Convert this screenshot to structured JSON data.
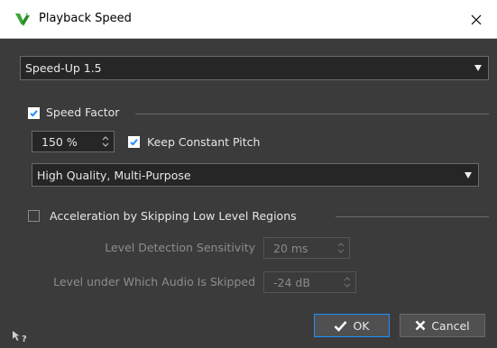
{
  "window": {
    "title": "Playback Speed"
  },
  "preset": {
    "value": "Speed-Up 1.5"
  },
  "speed_factor": {
    "label": "Speed Factor",
    "checked": true,
    "value": "150 %",
    "keep_pitch_label": "Keep Constant Pitch",
    "keep_pitch_checked": true,
    "quality_value": "High Quality, Multi-Purpose"
  },
  "acceleration": {
    "label": "Acceleration by Skipping Low Level Regions",
    "checked": false,
    "sensitivity_label": "Level Detection Sensitivity",
    "sensitivity_value": "20 ms",
    "threshold_label": "Level under Which Audio Is Skipped",
    "threshold_value": "-24 dB"
  },
  "buttons": {
    "ok_label": "OK",
    "cancel_label": "Cancel"
  },
  "icons": {
    "app": "wavelab-app-icon",
    "close": "close-icon",
    "help": "help-icon"
  },
  "colors": {
    "accent": "#1e90ff",
    "app_icon": "#3aa636",
    "background": "#3b3b3b",
    "field": "#262626"
  }
}
